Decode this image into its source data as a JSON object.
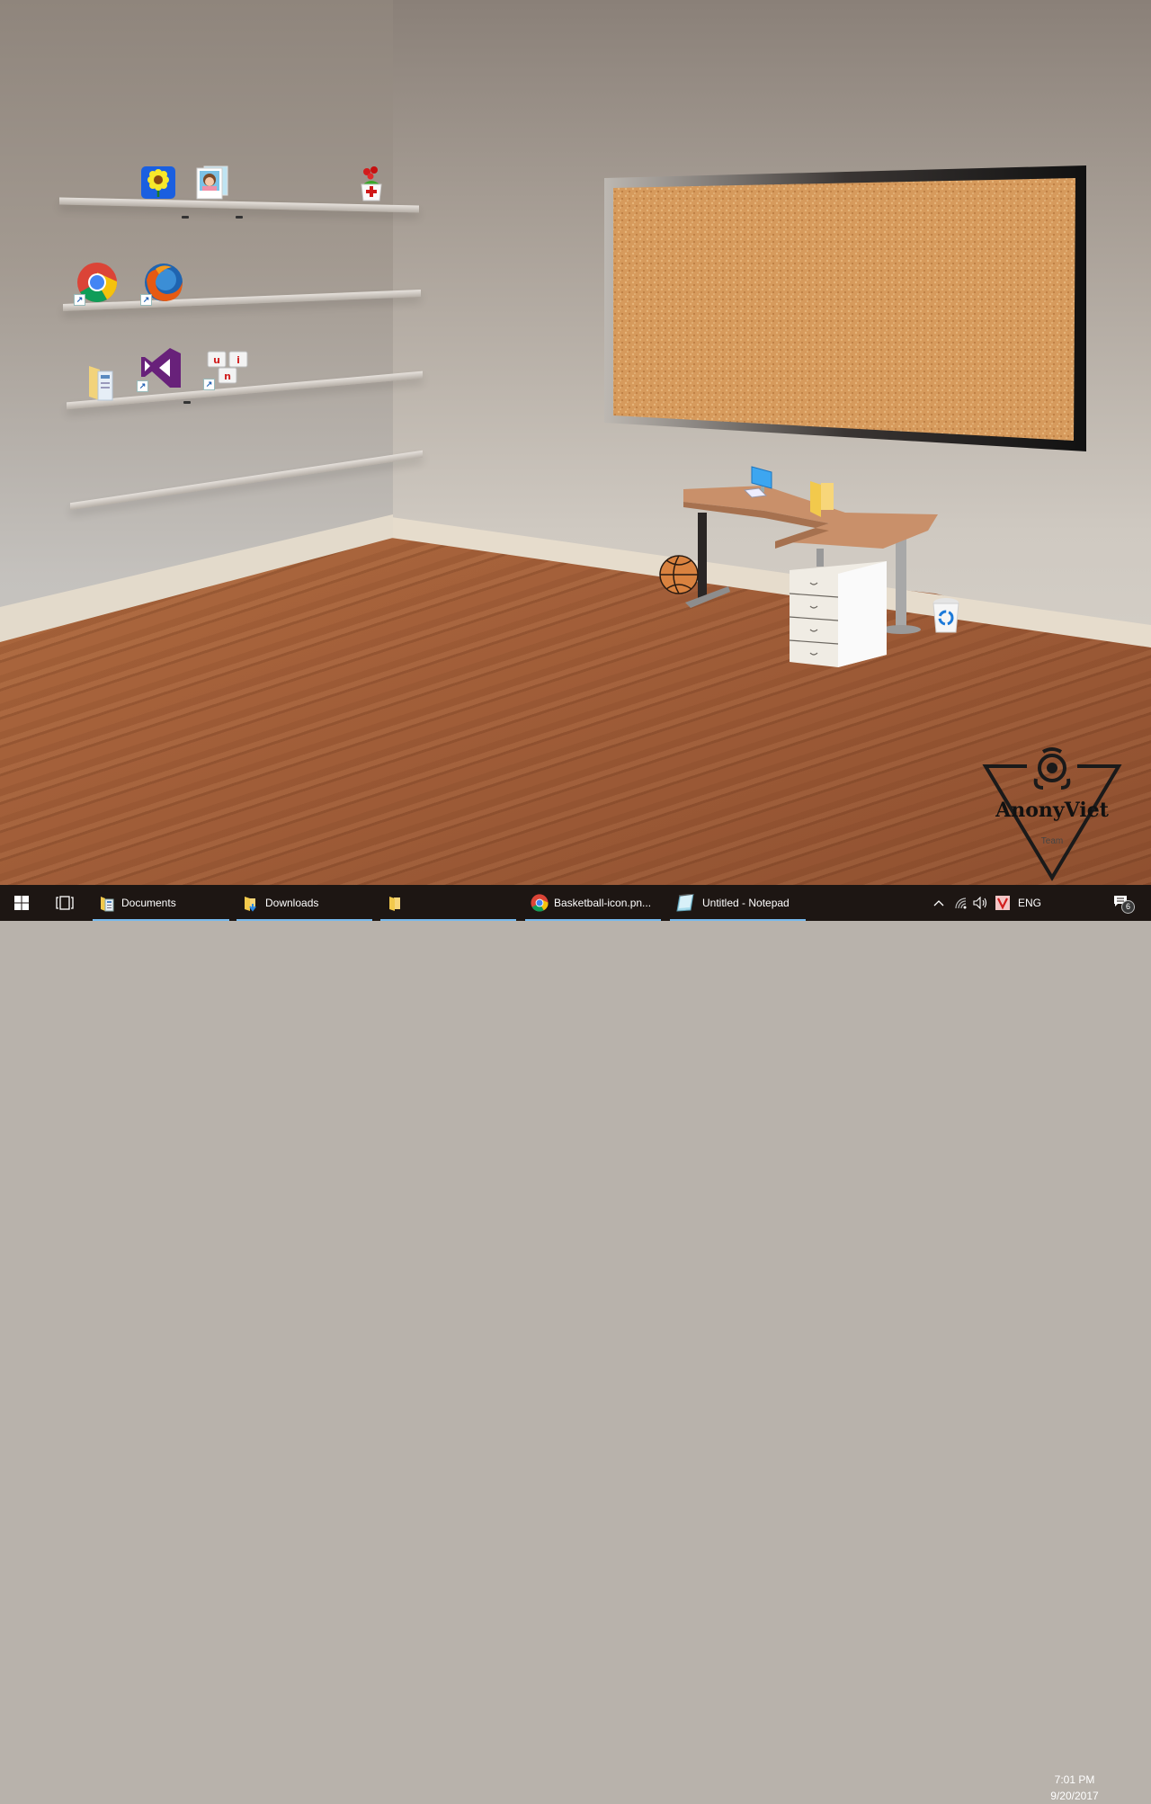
{
  "desktop": {
    "wallpaper": "3D room with wall shelves, cork board, corner desk",
    "icons": [
      {
        "name": "sunflower-icon",
        "shelf": 1,
        "shortcut": false
      },
      {
        "name": "photo-gallery-icon",
        "shelf": 1,
        "shortcut": false
      },
      {
        "name": "flower-pot-icon",
        "shelf": 1,
        "shortcut": false
      },
      {
        "name": "chrome-icon",
        "shelf": 2,
        "shortcut": true
      },
      {
        "name": "firefox-icon",
        "shelf": 2,
        "shortcut": true
      },
      {
        "name": "folder-documents-icon",
        "shelf": 3,
        "shortcut": false
      },
      {
        "name": "visual-studio-icon",
        "shelf": 3,
        "shortcut": true
      },
      {
        "name": "unikey-icon",
        "shelf": 3,
        "shortcut": true,
        "keys": [
          "u",
          "i",
          "n"
        ]
      },
      {
        "name": "this-pc-icon",
        "location": "desk",
        "shortcut": false
      },
      {
        "name": "folder-icon",
        "location": "desk",
        "shortcut": false
      },
      {
        "name": "basketball-icon",
        "location": "floor",
        "shortcut": false
      },
      {
        "name": "recycle-bin-icon",
        "location": "floor",
        "shortcut": false
      }
    ],
    "watermark": {
      "title": "AnonyViet",
      "subtitle": "Team"
    }
  },
  "taskbar": {
    "start_label": "Start",
    "task_view_label": "Task View",
    "items": [
      {
        "label": "Documents",
        "icon": "folder-documents-icon",
        "active": false
      },
      {
        "label": "Downloads",
        "icon": "folder-downloads-icon",
        "active": false
      },
      {
        "label": "",
        "icon": "folder-icon",
        "active": false
      },
      {
        "label": "Basketball-icon.pn...",
        "icon": "chrome-icon",
        "active": false
      },
      {
        "label": "Untitled - Notepad",
        "icon": "notepad-icon",
        "active": false
      }
    ],
    "tray": {
      "language": "ENG",
      "time": "7:01 PM",
      "date": "9/20/2017",
      "notification_count": "6"
    }
  },
  "colors": {
    "taskbar_bg": "#1d1613",
    "taskbar_underline": "#76b9ed",
    "cork": "#d9a060"
  }
}
